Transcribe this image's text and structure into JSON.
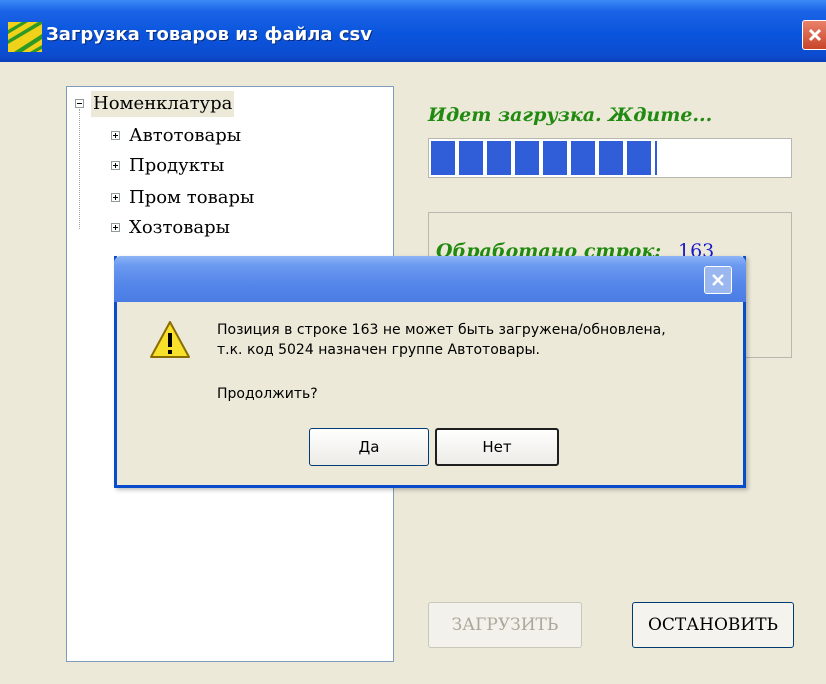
{
  "window": {
    "title": "Загрузка товаров из файла csv"
  },
  "tree": {
    "root": "Номенклатура",
    "items": [
      {
        "label": "Автотовары"
      },
      {
        "label": "Продукты"
      },
      {
        "label": "Пром товары"
      },
      {
        "label": "Хозтовары"
      }
    ]
  },
  "status": {
    "loading_text": "Идет загрузка. Ждите...",
    "progress_fraction": 0.63,
    "rows_label": "Обработано строк:",
    "rows_value": "163"
  },
  "buttons": {
    "load_label": "ЗАГРУЗИТЬ",
    "stop_label": "ОСТАНОВИТЬ"
  },
  "dialog": {
    "message_line1": "Позиция в строке 163 не может быть загружена/обновлена,",
    "message_line2": "т.к. код 5024 назначен группе Автотовары.",
    "question": "Продолжить?",
    "yes_label": "Да",
    "no_label": "Нет"
  },
  "icons": {
    "app": "stripes-logo-icon",
    "warning": "warning-icon",
    "close": "close-icon"
  },
  "colors": {
    "status_green": "#218a10",
    "value_blue": "#1a1acc",
    "progress_blue": "#2f5ed8",
    "title_blue": "#0a55dd"
  }
}
